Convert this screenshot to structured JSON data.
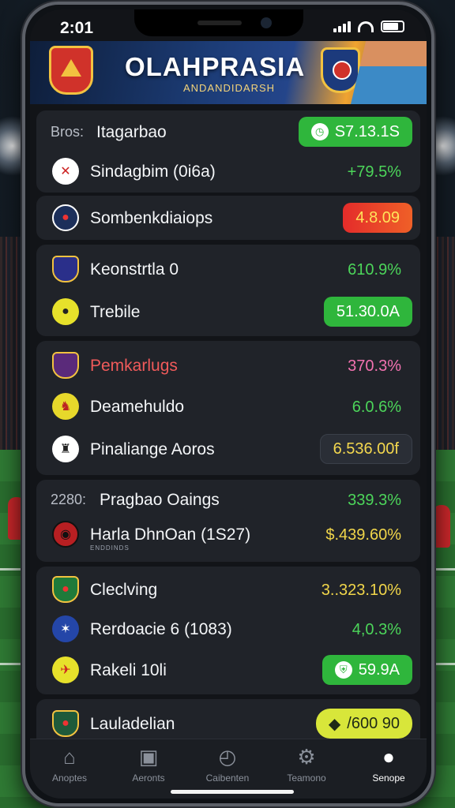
{
  "status_bar": {
    "time": "2:01"
  },
  "header": {
    "title": "OLAHPRASIA",
    "subtitle": "ANDANDIDARSH"
  },
  "rows": [
    {
      "prefix": "Bros:",
      "label": "Itagarbao",
      "value": "S7.13.1S",
      "style": "pill-green",
      "icon": "stopwatch-icon"
    },
    {
      "label": "Sindagbim (0i6a)",
      "value": "+79.5%",
      "style": "green-text",
      "icon": "club-crest-icon"
    },
    {
      "label": "Sombenkdiaiops",
      "value": "4.8.09",
      "style": "pill-red",
      "icon": "club-crest-icon"
    },
    {
      "label": "Keonstrtla 0",
      "value": "610.9%",
      "style": "green-text",
      "icon": "club-crest-icon"
    },
    {
      "label": "Trebile",
      "value": "51.30.0A",
      "style": "pill-green",
      "icon": "club-crest-icon"
    },
    {
      "label": "Pemkarlugs",
      "value": "370.3%",
      "style": "pink-text",
      "icon": "club-crest-icon",
      "label_red": true
    },
    {
      "label": "Deamehuldo",
      "value": "6.0.6%",
      "style": "green-text",
      "icon": "club-crest-icon"
    },
    {
      "label": "Pinaliange Aoros",
      "value": "6.536.00f",
      "style": "pill-dark",
      "icon": "club-crest-icon"
    },
    {
      "prefix": "2280:",
      "label": "Pragbao Oaings",
      "value": "339.3%",
      "style": "green-text"
    },
    {
      "label": "Harla DhnOan (1S27)",
      "sub": "ENDDINDS",
      "value": "$.439.60%",
      "style": "yellow-text",
      "icon": "club-crest-icon"
    },
    {
      "label": "Cleclving",
      "value": "3..323.10%",
      "style": "yellow-text",
      "icon": "club-crest-icon"
    },
    {
      "label": "Rerdoacie 6 (1083)",
      "value": "4,0.3%",
      "style": "green-text",
      "icon": "club-crest-icon"
    },
    {
      "label": "Rakeli 10li",
      "value": "59.9A",
      "style": "pill-green",
      "icon": "club-crest-icon"
    },
    {
      "label": "Lauladelian",
      "value": "/600 90",
      "style": "pill-yellow",
      "icon": "club-crest-icon"
    }
  ],
  "tabs": [
    {
      "label": "Anoptes",
      "icon": "home-icon"
    },
    {
      "label": "Aeronts",
      "icon": "box-icon"
    },
    {
      "label": "Caibenten",
      "icon": "clock-icon"
    },
    {
      "label": "Teamono",
      "icon": "gear-icon"
    },
    {
      "label": "Senope",
      "icon": "profile-icon",
      "active": true
    }
  ],
  "colors": {
    "accent_green": "#2fb63c",
    "accent_red": "#e42c2a",
    "accent_yellow": "#d8e63a",
    "background": "#121418"
  }
}
